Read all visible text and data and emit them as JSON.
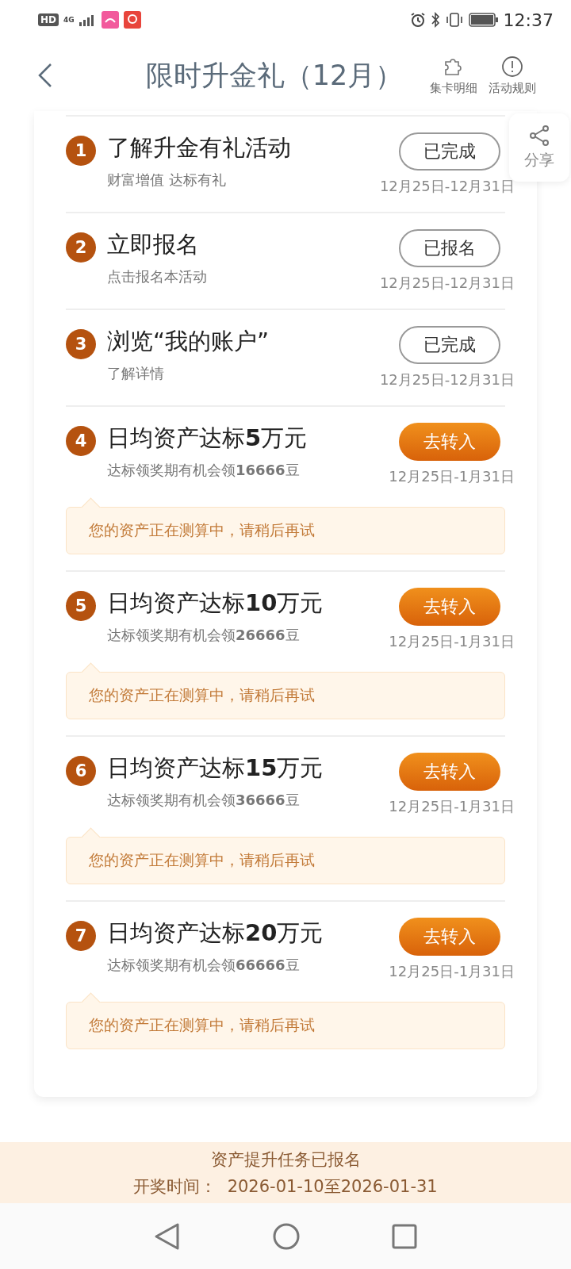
{
  "status_bar": {
    "hd": "HD",
    "network": "4G",
    "time": "12:37"
  },
  "header": {
    "title": "限时升金礼（12月）",
    "actions": [
      {
        "label": "集卡明细",
        "kind": "puzzle"
      },
      {
        "label": "活动规则",
        "kind": "rules"
      }
    ]
  },
  "share": {
    "label": "分享"
  },
  "tasks": [
    {
      "number": "1",
      "title": "了解升金有礼活动",
      "subtitle": "财富增值 达标有礼",
      "button": "已完成",
      "kind": "done",
      "date": "12月25日-12月31日"
    },
    {
      "number": "2",
      "title": "立即报名",
      "subtitle": "点击报名本活动",
      "button": "已报名",
      "kind": "done",
      "date": "12月25日-12月31日"
    },
    {
      "number": "3",
      "title": "浏览“我的账户”",
      "subtitle": "了解详情",
      "button": "已完成",
      "kind": "done",
      "date": "12月25日-12月31日"
    },
    {
      "number": "4",
      "title": "日均资产达标**5**万元",
      "subtitle": "达标领奖期有机会领**16666**豆",
      "button": "去转入",
      "kind": "action",
      "date": "12月25日-1月31日",
      "tip": "您的资产正在测算中，请稍后再试"
    },
    {
      "number": "5",
      "title": "日均资产达标**10**万元",
      "subtitle": "达标领奖期有机会领**26666**豆",
      "button": "去转入",
      "kind": "action",
      "date": "12月25日-1月31日",
      "tip": "您的资产正在测算中，请稍后再试"
    },
    {
      "number": "6",
      "title": "日均资产达标**15**万元",
      "subtitle": "达标领奖期有机会领**36666**豆",
      "button": "去转入",
      "kind": "action",
      "date": "12月25日-1月31日",
      "tip": "您的资产正在测算中，请稍后再试"
    },
    {
      "number": "7",
      "title": "日均资产达标**20**万元",
      "subtitle": "达标领奖期有机会领**66666**豆",
      "button": "去转入",
      "kind": "action",
      "date": "12月25日-1月31日",
      "tip": "您的资产正在测算中，请稍后再试"
    }
  ],
  "footer": {
    "status": "资产提升任务已报名",
    "draw_time": "开奖时间：  2026-01-10至2026-01-31"
  }
}
